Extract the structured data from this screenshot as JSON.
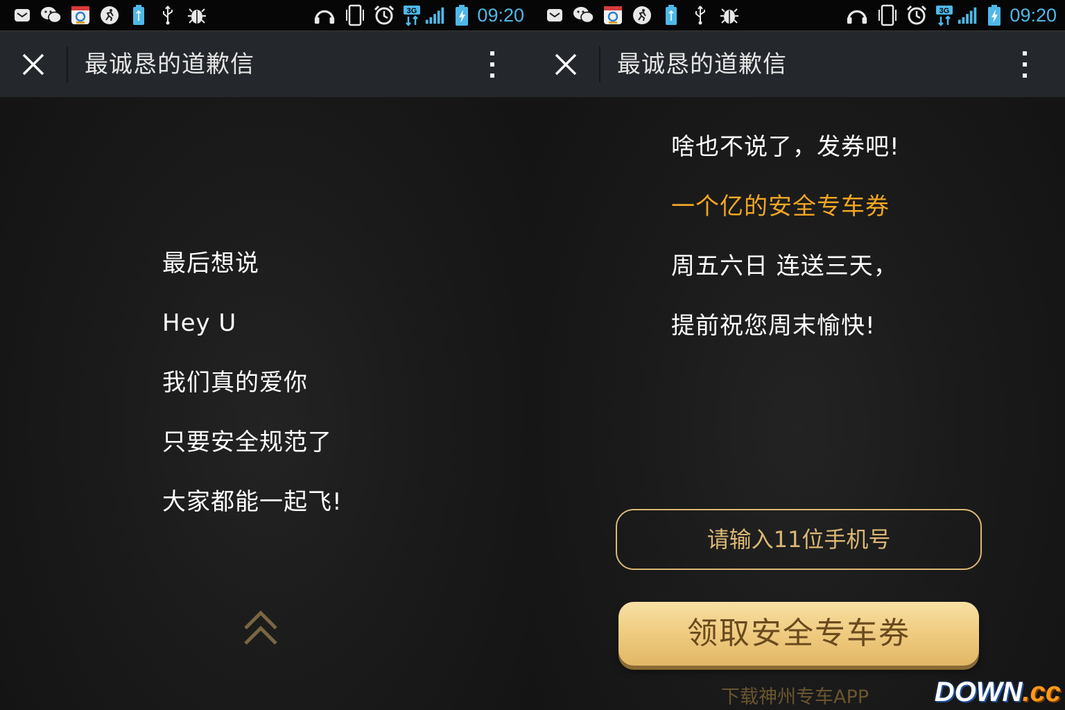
{
  "status_bar": {
    "time": "09:20",
    "network": "3G",
    "icons": [
      "mail-icon",
      "wechat-icon",
      "app-store-icon",
      "fitness-icon",
      "usb-storage-icon",
      "usb-icon",
      "android-debug-icon",
      "headphones-icon",
      "vibrate-icon",
      "alarm-icon",
      "network-3g-icon",
      "signal-icon",
      "battery-charging-icon"
    ]
  },
  "left_screen": {
    "title": "最诚恳的道歉信",
    "lines": [
      "最后想说",
      "Hey U",
      "我们真的爱你",
      "只要安全规范了",
      "大家都能一起飞!"
    ]
  },
  "right_screen": {
    "title": "最诚恳的道歉信",
    "lines": [
      "啥也不说了，发券吧!",
      "一个亿的安全专车券",
      "周五六日  连送三天，",
      "提前祝您周末愉快!"
    ],
    "phone_placeholder": "请输入11位手机号",
    "claim_button": "领取安全专车券",
    "download_link": "下载神州专车APP"
  },
  "watermark": {
    "main": "DOWN",
    "suffix": ".cc"
  },
  "colors": {
    "time_blue": "#4fb8e8",
    "gold_text": "#f0a623",
    "input_border": "#dcb874",
    "button_gold": "#f0cd83",
    "titlebar_bg": "#24282c"
  }
}
